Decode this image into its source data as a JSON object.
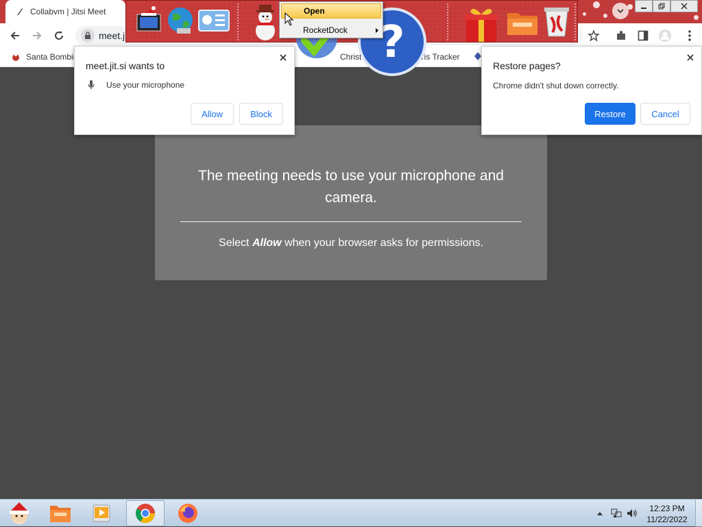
{
  "browser": {
    "tab_title": "Collabvm | Jitsi Meet",
    "url_visible": "meet.ji",
    "bookmarks": [
      "Santa Bombin",
      "Christ",
      "hris Tracker"
    ]
  },
  "rocketdock": {
    "menu_items": [
      "Open",
      "RocketDock"
    ],
    "icons": [
      "santa-hat-computer-icon",
      "globe-icon",
      "control-panel-icon",
      "snowman-icon",
      "checkmark-icon",
      "help-question-icon",
      "gift-box-icon",
      "folder-icon",
      "recycle-bin-icon"
    ]
  },
  "permission_prompt": {
    "title": "meet.jit.si wants to",
    "request": "Use your microphone",
    "allow_label": "Allow",
    "block_label": "Block"
  },
  "restore_prompt": {
    "title": "Restore pages?",
    "message": "Chrome didn't shut down correctly.",
    "restore_label": "Restore",
    "cancel_label": "Cancel"
  },
  "page": {
    "heading": "The meeting needs to use your microphone and camera.",
    "sub_prefix": "Select ",
    "sub_emphasis": "Allow",
    "sub_suffix": " when your browser asks for permissions."
  },
  "taskbar": {
    "apps": [
      "santa-start-icon",
      "folder-icon",
      "media-player-icon",
      "chrome-icon",
      "firefox-icon"
    ],
    "time": "12:23 PM",
    "date": "11/22/2022"
  },
  "colors": {
    "tabstrip": "#c23b3b",
    "accent_blue": "#1a73e8",
    "page_bg": "#494949",
    "card_bg": "#777777"
  }
}
